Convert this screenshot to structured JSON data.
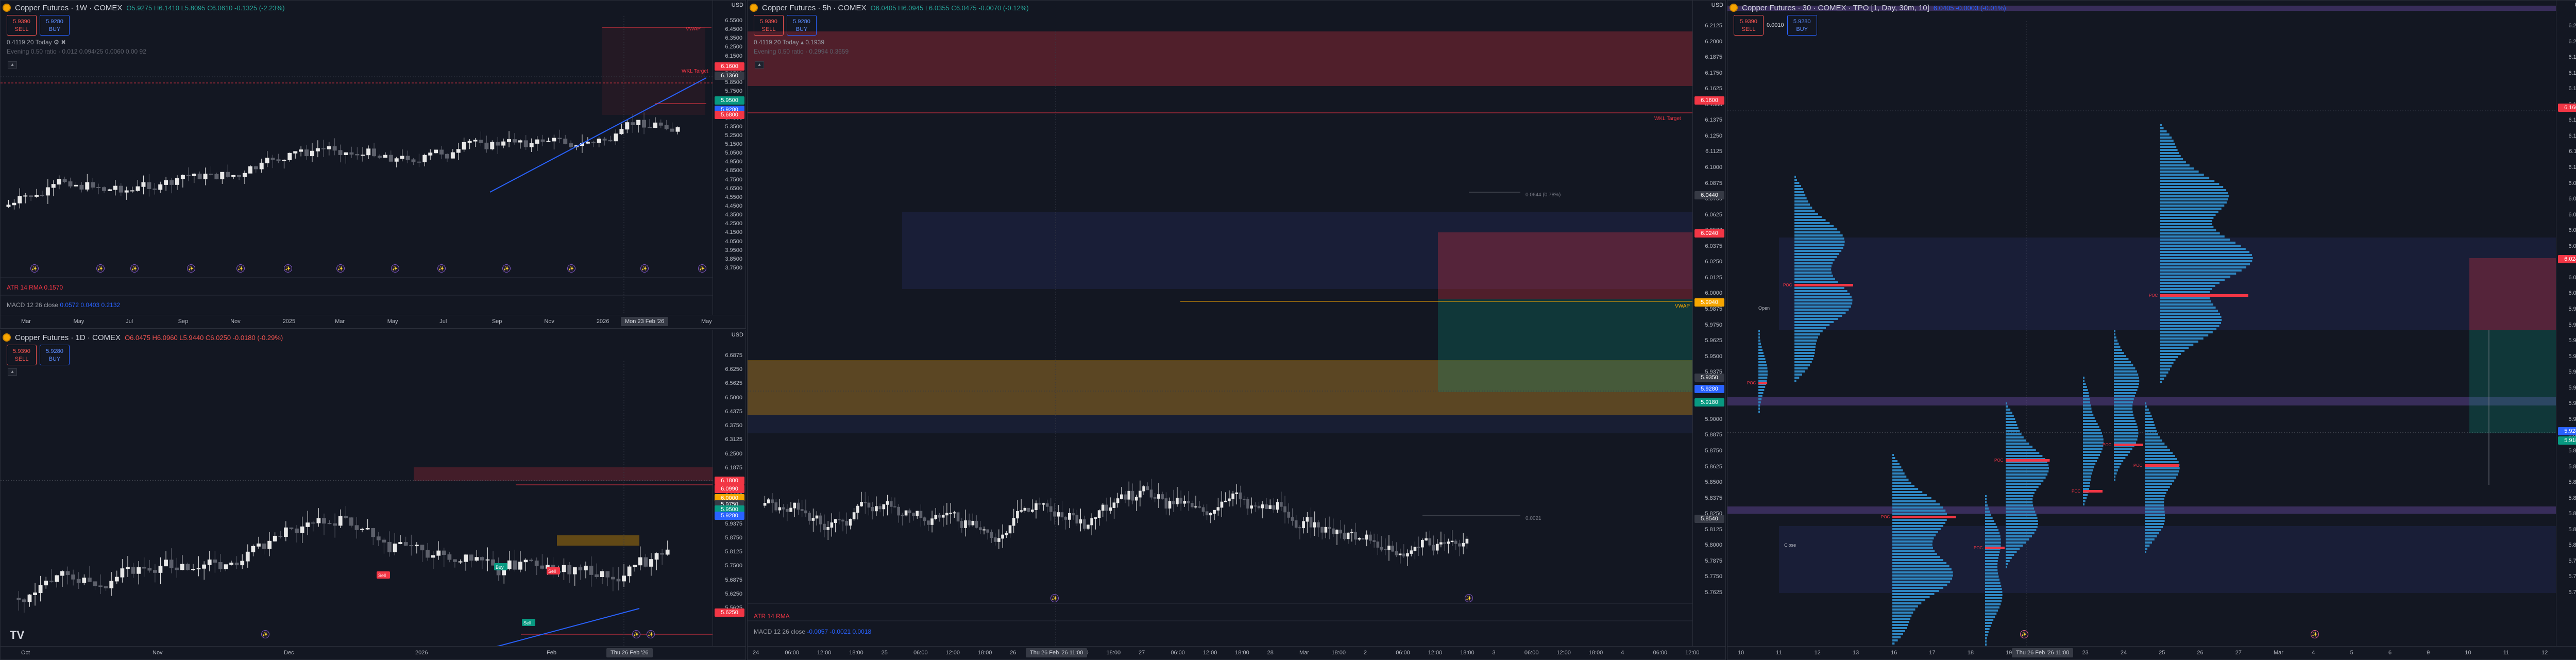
{
  "panes": {
    "weekly": {
      "title": "Copper Futures · 1W · COMEX",
      "ohlc": "O5.9275  H6.1410  L5.8095  C6.0610  -0.1325 (-2.23%)",
      "sell_price": "5.9390",
      "sell_label": "SELL",
      "buy_price": "5.9280",
      "buy_label": "BUY",
      "spread": "0.0010",
      "ind1": "0.4119 20  Today  ⚙  ✖",
      "ind2": "Evening 0.50 ratio  ·  0.012 0.094/25 0.0060 0.00 92",
      "atr": "ATR 14 RMA",
      "atr_val": "0.1570",
      "macd": "MACD 12 26 close",
      "macd_vals": "0.0572  0.0403  0.2132",
      "price_labels": [
        "6.5500",
        "6.4500",
        "6.3500",
        "6.2500",
        "6.1500",
        "6.0500",
        "5.9500",
        "5.8500",
        "5.7500",
        "5.6500",
        "5.5500",
        "5.4500",
        "5.3500",
        "5.2500",
        "5.1500",
        "5.0500",
        "4.9500",
        "4.8500",
        "4.7500",
        "4.6500",
        "4.5500",
        "4.4500",
        "4.3500",
        "4.2500",
        "4.1500",
        "4.0500",
        "3.9500",
        "3.8500",
        "3.7500"
      ],
      "tags": [
        {
          "v": "6.1600",
          "c": "#f23645"
        },
        {
          "v": "6.1360",
          "c": "#363a45"
        },
        {
          "v": "5.9500",
          "c": "#089981"
        },
        {
          "v": "5.9280",
          "c": "#2962ff"
        },
        {
          "v": "5.6800",
          "c": "#f23645"
        }
      ],
      "time_labels": [
        "Mar",
        "May",
        "Jul",
        "Sep",
        "Nov",
        "2025",
        "Mar",
        "May",
        "Jul",
        "Sep",
        "Nov",
        "2026",
        "Mar",
        "May"
      ],
      "time_hl": "Mon 23 Feb '26",
      "currency": "USD",
      "wkly_tag": "WKL Target",
      "vwap": "VWAP"
    },
    "daily": {
      "title": "Copper Futures · 1D · COMEX",
      "ohlc": "O6.0475  H6.0960  L5.9440  C6.0250  -0.0180 (-0.29%)",
      "sell_price": "5.9390",
      "sell_label": "SELL",
      "buy_price": "5.9280",
      "buy_label": "BUY",
      "spread": "0.0010",
      "price_labels": [
        "6.6875",
        "6.6250",
        "6.5625",
        "6.5000",
        "6.4375",
        "6.3750",
        "6.3125",
        "6.2500",
        "6.1875",
        "6.1250",
        "6.0625",
        "6.0000",
        "5.9375",
        "5.8750",
        "5.8125",
        "5.7500",
        "5.6875",
        "5.6250",
        "5.5625"
      ],
      "tags": [
        {
          "v": "6.1800",
          "c": "#f23645"
        },
        {
          "v": "6.0990",
          "c": "#f23645"
        },
        {
          "v": "6.0000",
          "c": "#f7a600"
        },
        {
          "v": "5.9750",
          "c": "#363a45"
        },
        {
          "v": "5.9500",
          "c": "#089981"
        },
        {
          "v": "5.9280",
          "c": "#2962ff"
        },
        {
          "v": "5.6250",
          "c": "#f23645"
        }
      ],
      "time_labels": [
        "Oct",
        "Nov",
        "Dec",
        "2026",
        "Feb"
      ],
      "time_hl": "Thu 26 Feb '26",
      "currency": "USD",
      "events": [
        "Sell",
        "Sell",
        "Buy",
        "Sell"
      ],
      "tv_logo": "TV"
    },
    "intraday": {
      "title": "Copper Futures · 5h · COMEX",
      "ohlc": "O6.0405  H6.0945  L6.0355  C6.0475  -0.0070 (-0.12%)",
      "sell_price": "5.9390",
      "sell_label": "SELL",
      "buy_price": "5.9280",
      "buy_label": "BUY",
      "ind1": "0.4119 20  Today  ▴  0.1939",
      "ind2": "Evening 0.50 ratio  ·  0.2994  0.3659",
      "atr": "ATR 14 RMA",
      "macd": "MACD 12 26 close",
      "macd_vals": "-0.0057  -0.0021  0.0018",
      "note1": "0.0644 (0.78%)",
      "note2": "0.0021",
      "price_labels": [
        "6.2125",
        "6.2000",
        "6.1875",
        "6.1750",
        "6.1625",
        "6.1500",
        "6.1375",
        "6.1250",
        "6.1125",
        "6.1000",
        "6.0875",
        "6.0750",
        "6.0625",
        "6.0500",
        "6.0375",
        "6.0250",
        "6.0125",
        "6.0000",
        "5.9875",
        "5.9750",
        "5.9625",
        "5.9500",
        "5.9375",
        "5.9250",
        "5.9125",
        "5.9000",
        "5.8875",
        "5.8750",
        "5.8625",
        "5.8500",
        "5.8375",
        "5.8250",
        "5.8125",
        "5.8000",
        "5.7875",
        "5.7750",
        "5.7625"
      ],
      "tags": [
        {
          "v": "6.1600",
          "c": "#f23645"
        },
        {
          "v": "6.0440",
          "c": "#363a45"
        },
        {
          "v": "6.0240",
          "c": "#f23645"
        },
        {
          "v": "5.9940",
          "c": "#f7a600"
        },
        {
          "v": "5.9350",
          "c": "#363a45"
        },
        {
          "v": "5.9280",
          "c": "#2962ff"
        },
        {
          "v": "5.9180",
          "c": "#089981"
        },
        {
          "v": "5.8540",
          "c": "#363a45"
        }
      ],
      "time_labels": [
        "24",
        "06:00",
        "12:00",
        "18:00",
        "25",
        "06:00",
        "12:00",
        "18:00",
        "26",
        "06:00",
        "12:00",
        "18:00",
        "27",
        "06:00",
        "12:00",
        "18:00",
        "28",
        "Mar",
        "18:00",
        "2",
        "06:00",
        "12:00",
        "18:00",
        "3",
        "06:00",
        "12:00",
        "18:00",
        "4",
        "06:00",
        "12:00"
      ],
      "time_hl": "Thu 26 Feb '26  11:00",
      "currency": "USD",
      "wkly_tag": "WKL Target",
      "vwap": "VWAP"
    },
    "tpo": {
      "title": "Copper Futures · 30 · COMEX · TPO [1, Day, 30m, 10]",
      "ohlc": "6.0405  -0.0003 (-0.01%)",
      "sell_price": "5.9390",
      "sell_label": "SELL",
      "buy_price": "5.9280",
      "buy_label": "BUY",
      "spread": "0.0010",
      "price_labels": [
        "6.2125",
        "6.2000",
        "6.1875",
        "6.1750",
        "6.1625",
        "6.1500",
        "6.1375",
        "6.1250",
        "6.1125",
        "6.1000",
        "6.0875",
        "6.0750",
        "6.0625",
        "6.0500",
        "6.0375",
        "6.0250",
        "6.0125",
        "6.0000",
        "5.9875",
        "5.9750",
        "5.9625",
        "5.9500",
        "5.9375",
        "5.9250",
        "5.9125",
        "5.9000",
        "5.8875",
        "5.8750",
        "5.8625",
        "5.8500",
        "5.8375",
        "5.8250",
        "5.8125",
        "5.8000",
        "5.7875",
        "5.7750",
        "5.7625"
      ],
      "tags": [
        {
          "v": "6.1600",
          "c": "#f23645"
        },
        {
          "v": "6.0240",
          "c": "#f23645"
        },
        {
          "v": "5.9280",
          "c": "#2962ff"
        },
        {
          "v": "5.9180",
          "c": "#089981"
        }
      ],
      "time_labels": [
        "10",
        "11",
        "12",
        "13",
        "16",
        "17",
        "18",
        "19",
        "20",
        "23",
        "24",
        "25",
        "26",
        "27",
        "Mar",
        "4",
        "5",
        "6",
        "9",
        "10",
        "11",
        "12"
      ],
      "time_hl": "Thu 26 Feb '26  11:00",
      "currency": "USD",
      "labels": {
        "poc": "POC",
        "open": "Open",
        "close": "Close"
      }
    }
  },
  "colors": {
    "bg": "#131722",
    "up": "#e8e8e8",
    "down": "#5d606b",
    "red": "#f23645",
    "green": "#089981",
    "blue": "#2962ff",
    "orange": "#f7a600",
    "purple": "#7e57c2",
    "tpo": "#2e86c1"
  }
}
